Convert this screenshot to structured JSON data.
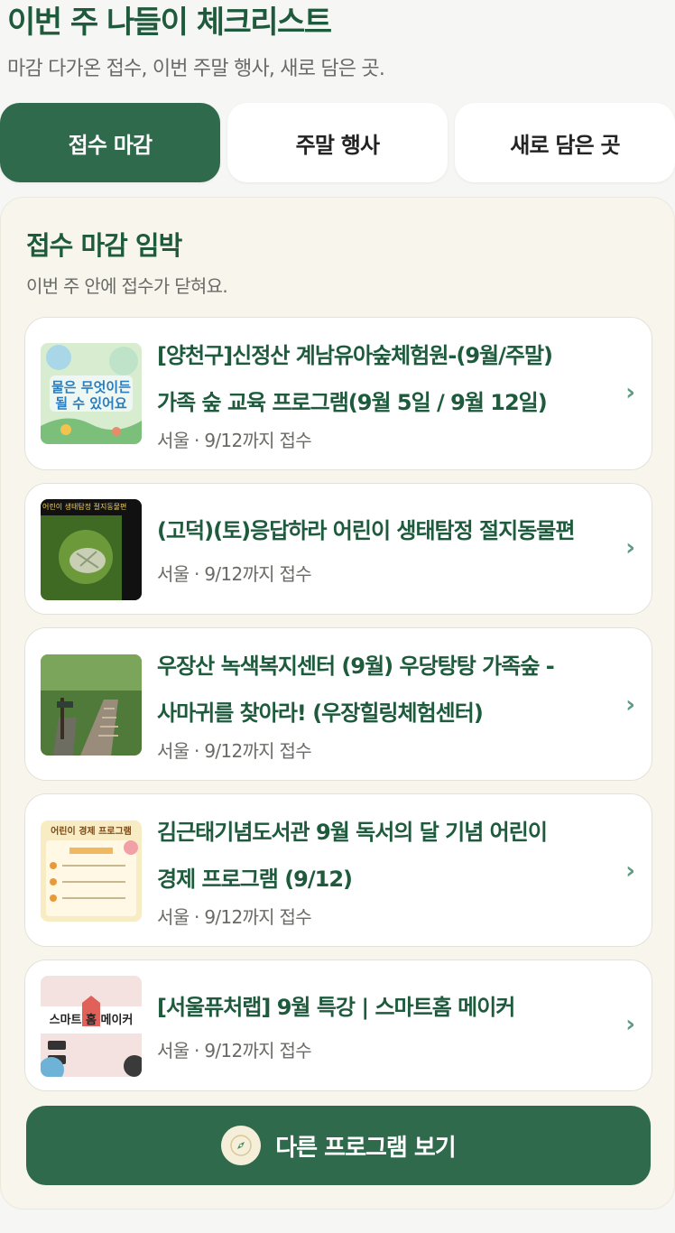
{
  "header": {
    "title": "이번 주 나들이 체크리스트",
    "subtitle": "마감 다가온 접수, 이번 주말 행사, 새로 담은 곳."
  },
  "tabs": [
    {
      "label": "접수 마감",
      "active": true
    },
    {
      "label": "주말 행사",
      "active": false
    },
    {
      "label": "새로 담은 곳",
      "active": false
    }
  ],
  "panel": {
    "title": "접수 마감 임박",
    "subtitle": "이번 주 안에 접수가 닫혀요."
  },
  "items": [
    {
      "title_line1": "[양천구]신정산 계남유아숲체험원-(9월/주말)",
      "title_line2": "가족 숲 교육 프로그램(9월 5일 / 9월 12일)",
      "meta": "서울 · 9/12까지 접수",
      "thumb_text": "물은 무엇이든 될 수 있어요"
    },
    {
      "title_line1": "(고덕)(토)응답하라 어린이 생태탐정 절지동물편",
      "title_line2": "",
      "meta": "서울 · 9/12까지 접수",
      "thumb_text": "어린이 생태탐정 절지동물편"
    },
    {
      "title_line1": "우장산 녹색복지센터 (9월) 우당탕탕 가족숲 -",
      "title_line2": "사마귀를 찾아라! (우장힐링체험센터)",
      "meta": "서울 · 9/12까지 접수",
      "thumb_text": ""
    },
    {
      "title_line1": "김근태기념도서관 9월 독서의 달 기념 어린이",
      "title_line2": "경제 프로그램 (9/12)",
      "meta": "서울 · 9/12까지 접수",
      "thumb_text": "어린이 경제 프로그램"
    },
    {
      "title_line1": "[서울퓨처랩] 9월 특강 | 스마트홈 메이커",
      "title_line2": "",
      "meta": "서울 · 9/12까지 접수",
      "thumb_text": "스마트 홈 메이커"
    }
  ],
  "chevron": "›",
  "cta": {
    "label": "다른 프로그램 보기",
    "icon": "compass-icon"
  },
  "colors": {
    "brand": "#2f6a4c",
    "title": "#1e5a3c",
    "panel_bg": "#f7f5ec"
  }
}
